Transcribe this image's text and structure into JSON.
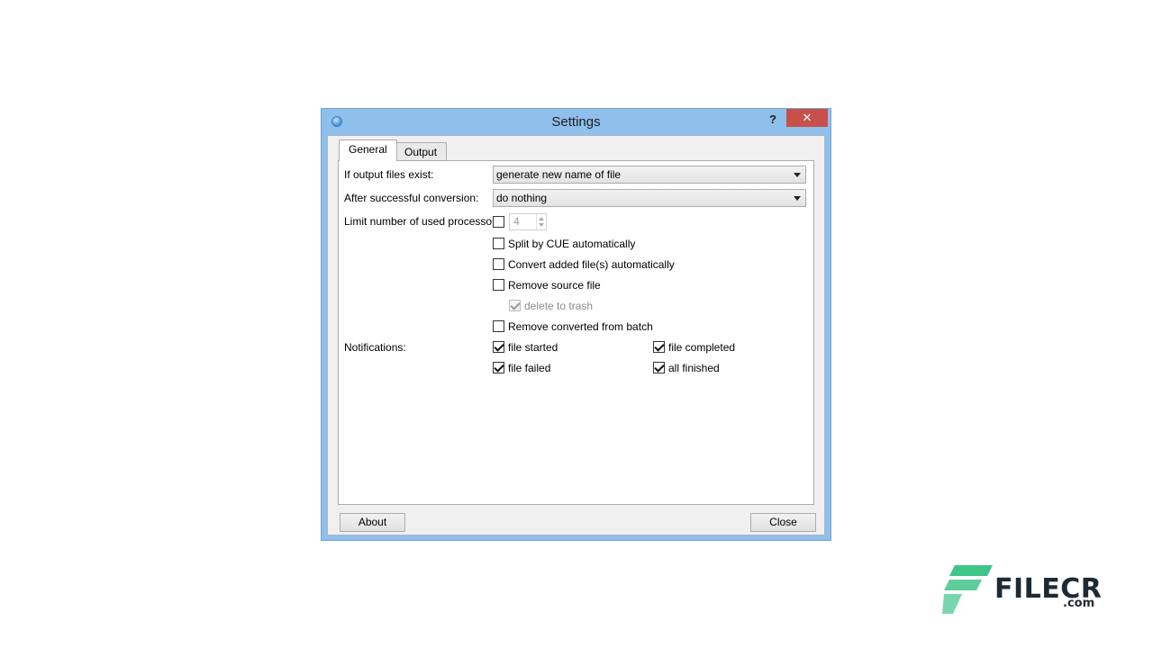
{
  "window": {
    "title": "Settings",
    "help": "?",
    "close": "✕"
  },
  "tabs": [
    {
      "label": "General",
      "active": true
    },
    {
      "label": "Output",
      "active": false
    }
  ],
  "general": {
    "if_output_exists": {
      "label": "If output files exist:",
      "value": "generate new name of file"
    },
    "after_conversion": {
      "label": "After successful conversion:",
      "value": "do nothing"
    },
    "limit_processors": {
      "label": "Limit number of used processors:",
      "checked": false,
      "value": "4"
    },
    "options": [
      {
        "label": "Split by CUE automatically",
        "checked": false
      },
      {
        "label": "Convert added file(s) automatically",
        "checked": false
      },
      {
        "label": "Remove source file",
        "checked": false
      }
    ],
    "delete_to_trash": {
      "label": "delete to trash",
      "checked": true,
      "disabled": true
    },
    "remove_converted": {
      "label": "Remove converted from batch",
      "checked": false
    },
    "notifications": {
      "label": "Notifications:",
      "items": [
        {
          "label": "file started",
          "checked": true
        },
        {
          "label": "file completed",
          "checked": true
        },
        {
          "label": "file failed",
          "checked": true
        },
        {
          "label": "all finished",
          "checked": true
        }
      ]
    }
  },
  "buttons": {
    "about": "About",
    "close": "Close"
  },
  "watermark": {
    "brand": "FILECR",
    "suffix": ".com",
    "color": "#3fc48a"
  }
}
